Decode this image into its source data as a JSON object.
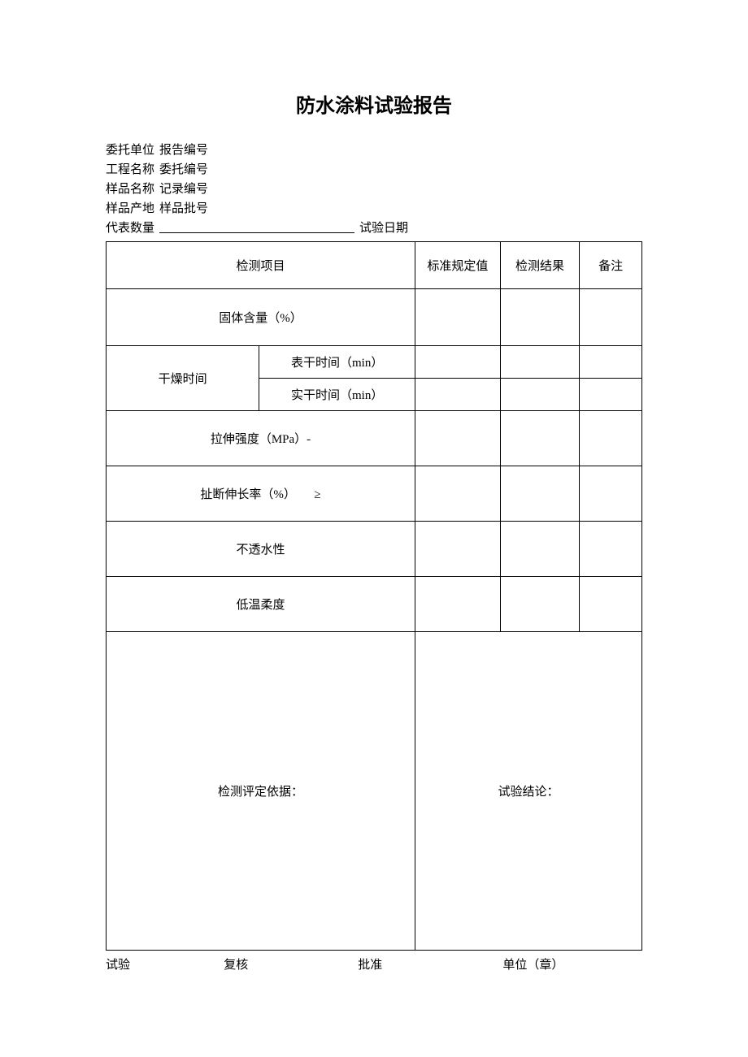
{
  "title": "防水涂料试验报告",
  "header": {
    "row1a": "委托单位",
    "row1b": "报告编号",
    "row2a": "工程名称",
    "row2b": "委托编号",
    "row3a": "样品名称",
    "row3b": "记录编号",
    "row4a": "样品产地",
    "row4b": "样品批号",
    "row5a": "代表数量",
    "row5b": "试验日期"
  },
  "table": {
    "head": {
      "item": "检测项目",
      "std": "标准规定值",
      "result": "检测结果",
      "note": "备注"
    },
    "rows": {
      "solid": "固体含量（%）",
      "dry": "干燥时间",
      "dry_surface": "表干时间（min）",
      "dry_full": "实干时间（min）",
      "tensile": "拉伸强度（MPa）-",
      "elongation": "扯断伸长率（%）　　≥",
      "waterproof": "不透水性",
      "lowtemp": "低温柔度"
    },
    "basis": "检测评定依据：",
    "conclusion": "试验结论："
  },
  "footer": {
    "test": "试验",
    "review": "复核",
    "approve": "批准",
    "unit": "单位（章）"
  }
}
